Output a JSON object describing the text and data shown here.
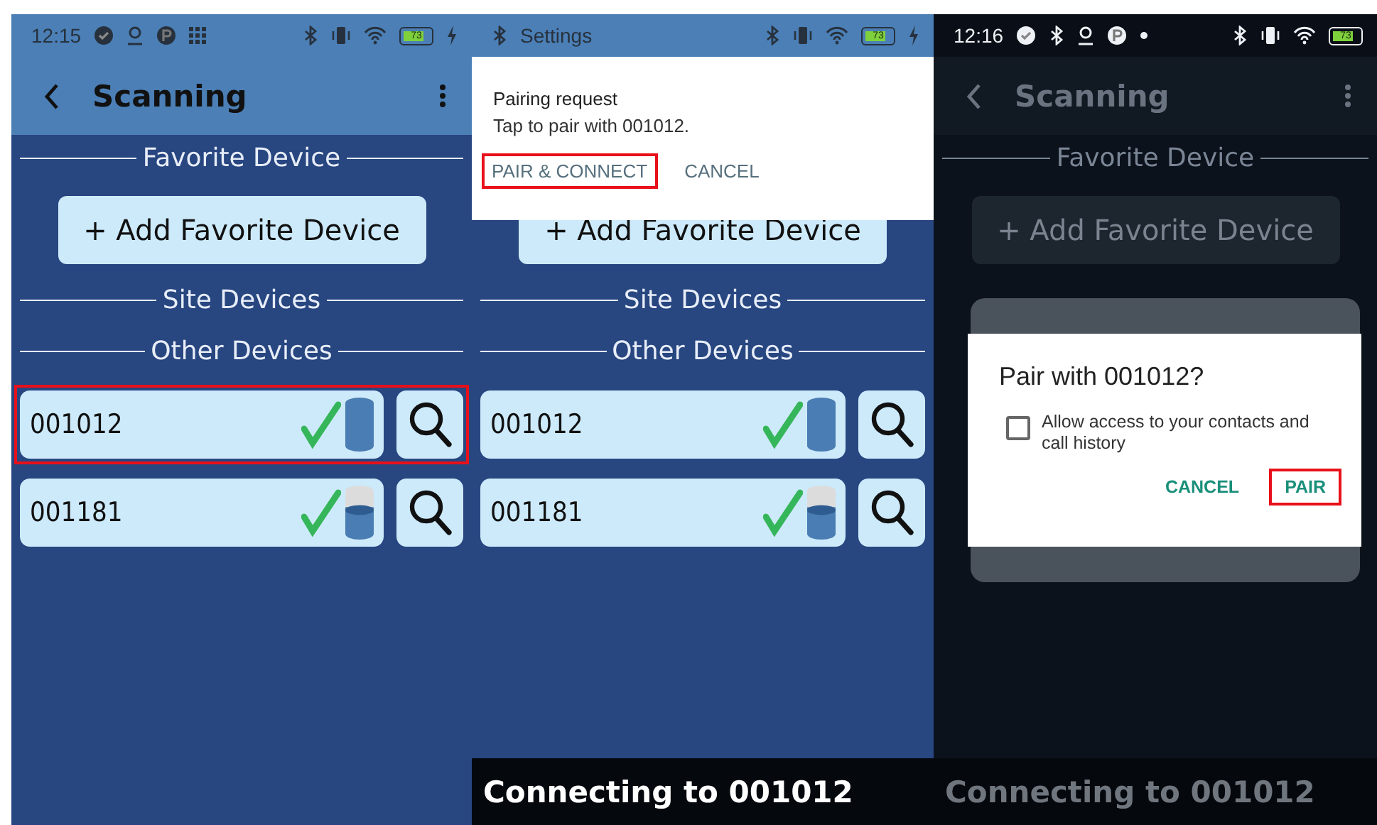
{
  "panels": [
    {
      "kind": "scanning",
      "status_bar": {
        "time": "12:15",
        "battery": "73"
      },
      "app_bar": {
        "title": "Scanning"
      },
      "content": [
        {
          "kind": "divider",
          "label": "Favorite Device"
        },
        {
          "kind": "add_button",
          "label": "+ Add Favorite Device"
        },
        {
          "kind": "divider",
          "label": "Site Devices"
        },
        {
          "kind": "divider",
          "label": "Other Devices"
        },
        {
          "kind": "device",
          "name": "001012",
          "connected": true,
          "level": 1,
          "highlighted": true
        },
        {
          "kind": "device",
          "name": "001181",
          "connected": true,
          "level": 0.6,
          "highlighted": false
        }
      ]
    },
    {
      "kind": "pairing_request",
      "status_bar": {
        "app": "Settings",
        "battery": "73"
      },
      "dialog": {
        "title": "Pairing request",
        "message": "Tap to pair with 001012.",
        "buttons": [
          {
            "label": "PAIR & CONNECT",
            "highlighted": true
          },
          {
            "label": "CANCEL",
            "highlighted": false
          }
        ]
      },
      "content": [
        {
          "kind": "add_button",
          "label": "+ Add Favorite Device"
        },
        {
          "kind": "divider",
          "label": "Site Devices"
        },
        {
          "kind": "divider",
          "label": "Other Devices"
        },
        {
          "kind": "device",
          "name": "001012",
          "connected": true,
          "level": 1,
          "highlighted": false
        },
        {
          "kind": "device",
          "name": "001181",
          "connected": true,
          "level": 0.6,
          "highlighted": false
        }
      ],
      "snackbar": "Connecting to 001012"
    },
    {
      "kind": "pair_dialog",
      "status_bar": {
        "time": "12:16",
        "battery": "73"
      },
      "app_bar": {
        "title": "Scanning"
      },
      "content": [
        {
          "kind": "divider",
          "label": "Favorite Device"
        },
        {
          "kind": "add_button",
          "label": "+ Add Favorite Device"
        }
      ],
      "dialog": {
        "title": "Pair with 001012?",
        "checkbox": {
          "label": "Allow access to your contacts and call history",
          "checked": false
        },
        "buttons": [
          {
            "label": "CANCEL",
            "highlighted": false
          },
          {
            "label": "PAIR",
            "highlighted": true
          }
        ]
      },
      "snackbar": "Connecting to 001012"
    }
  ]
}
